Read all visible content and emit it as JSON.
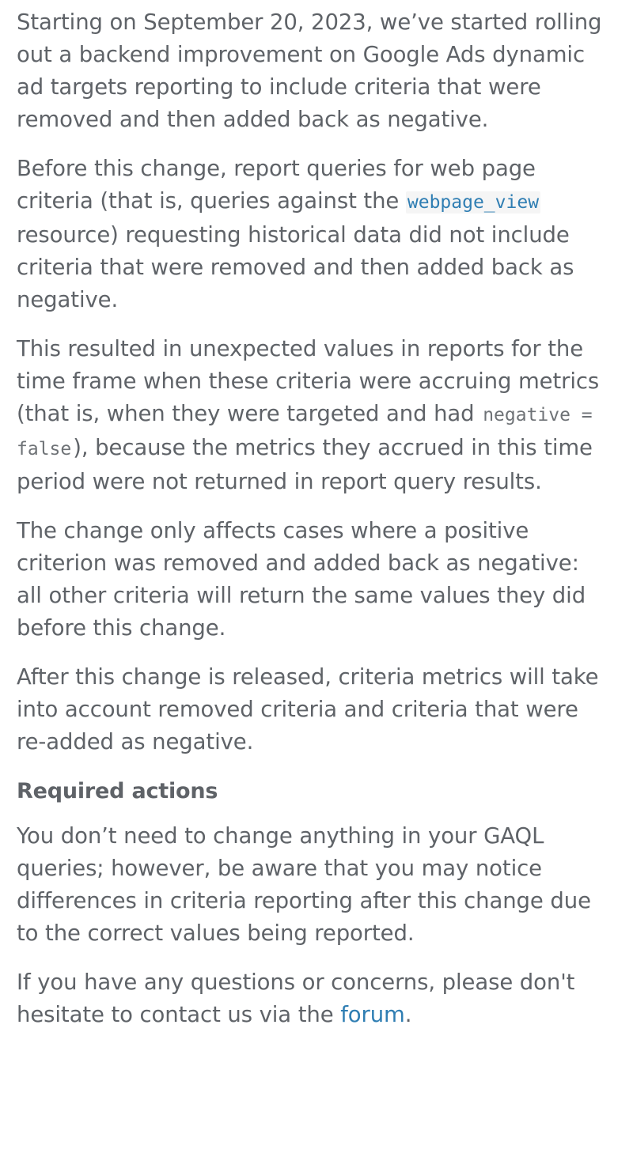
{
  "document": {
    "background_color": "#ffffff",
    "body_text_color": "#5f6368",
    "link_color": "#2f7eb3",
    "code_blue_color": "#2f7eb3",
    "code_gray_color": "#6e7276",
    "code_background_color": "#f5f5f5"
  },
  "paragraphs": {
    "p1": "Starting on September 20, 2023, we’ve started rolling out a backend improvement on Google Ads dynamic ad targets reporting to include criteria that were removed and then added back as negative.",
    "p2_part1": "Before this change, report queries for web page criteria (that is, queries against the ",
    "p2_code": "webpage_view",
    "p2_part2": " resource) requesting historical data did not include criteria that were removed and then added back as negative.",
    "p3_part1": "This resulted in unexpected values in reports for the time frame when these criteria were accruing metrics (that is, when they were targeted and had ",
    "p3_code": "negative = false",
    "p3_part2": "), because the metrics they accrued in this time period were not returned in report query results.",
    "p4": "The change only affects cases where a positive criterion was removed and added back as negative: all other criteria will return the same values they did before this change.",
    "p5": "After this change is released, criteria metrics will take into account removed criteria and criteria that were re-added as negative.",
    "heading_required_actions": "Required actions",
    "p6": "You don’t need to change anything in your GAQL queries; however, be aware that you may notice differences in criteria reporting after this change due to the correct values being reported.",
    "p7_part1": "If you have any questions or concerns, please don't hesitate to contact us via the ",
    "p7_link": "forum",
    "p7_part2": "."
  }
}
